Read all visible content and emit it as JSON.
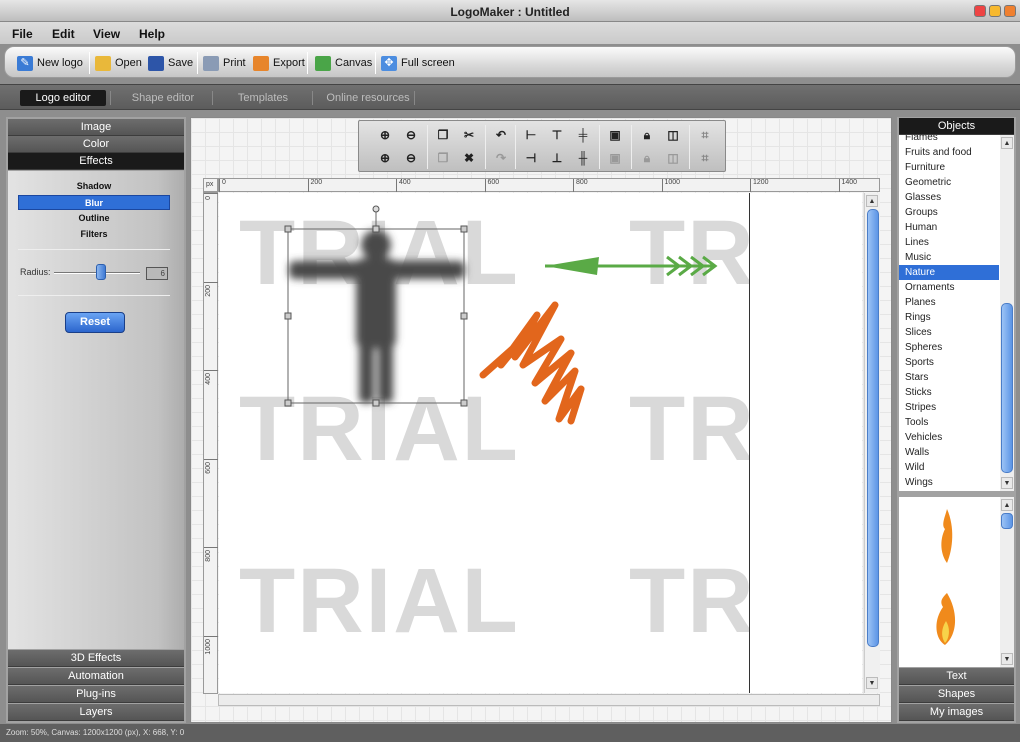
{
  "window": {
    "title": "LogoMaker : Untitled"
  },
  "menu": [
    "File",
    "Edit",
    "View",
    "Help"
  ],
  "toolbar": {
    "new": "New logo",
    "open": "Open",
    "save": "Save",
    "print": "Print",
    "export": "Export",
    "canvas": "Canvas",
    "fullscreen": "Full screen"
  },
  "tabs": [
    "Logo editor",
    "Shape editor",
    "Templates",
    "Online resources"
  ],
  "left_panel": {
    "image": "Image",
    "color": "Color",
    "effects": "Effects",
    "effect_items": [
      "Shadow",
      "Blur",
      "Outline",
      "Filters"
    ],
    "selected_effect": "Blur",
    "radius_label": "Radius:",
    "radius_value": "6",
    "radius_slider": 0.55,
    "reset": "Reset",
    "bottom": [
      "3D Effects",
      "Automation",
      "Plug-ins",
      "Layers"
    ]
  },
  "ruler": {
    "unit": "px",
    "h_labels": [
      "0",
      "200",
      "400",
      "600",
      "800",
      "1000",
      "1200",
      "1400"
    ],
    "v_labels": [
      "0",
      "200",
      "400",
      "600",
      "800",
      "1000"
    ]
  },
  "canvas": {
    "watermark": "TRIAL",
    "watermark_cut": "TR"
  },
  "right_panel": {
    "objects_header": "Objects",
    "objects": [
      "Flames",
      "Fruits and food",
      "Furniture",
      "Geometric",
      "Glasses",
      "Groups",
      "Human",
      "Lines",
      "Music",
      "Nature",
      "Ornaments",
      "Planes",
      "Rings",
      "Slices",
      "Spheres",
      "Sports",
      "Stars",
      "Sticks",
      "Stripes",
      "Tools",
      "Vehicles",
      "Walls",
      "Wild",
      "Wings"
    ],
    "selected": "Nature",
    "bottom": [
      "Text",
      "Shapes",
      "My images"
    ]
  },
  "status": "Zoom: 50%, Canvas: 1200x1200 (px), X: 668, Y: 0",
  "colors": {
    "accent": "#2f6fd7",
    "arrow": "#5aaa46",
    "scribble": "#e2661c",
    "flame": "#f08a1c"
  }
}
